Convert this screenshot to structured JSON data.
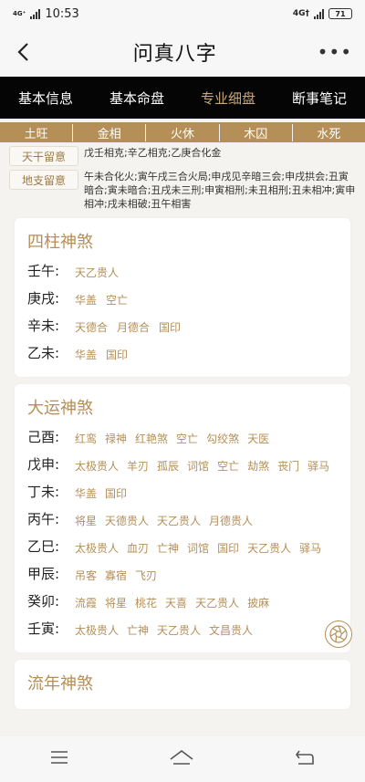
{
  "status": {
    "network": "4G⁺",
    "time": "10:53",
    "right_network": "4G†",
    "battery": "71"
  },
  "header": {
    "title": "问真八字"
  },
  "tabs": [
    {
      "label": "基本信息"
    },
    {
      "label": "基本命盘"
    },
    {
      "label": "专业细盘"
    },
    {
      "label": "断事笔记"
    }
  ],
  "wuxing": [
    "土旺",
    "金相",
    "火休",
    "木囚",
    "水死"
  ],
  "liu": {
    "tiangan_label": "天干留意",
    "tiangan_text": "戊壬相克;辛乙相克;乙庚合化金",
    "dizhi_label": "地支留意",
    "dizhi_text": "午未合化火;寅午戌三合火局;申戌见辛暗三会;申戌拱会;丑寅暗合;寅未暗合;丑戌未三刑;申寅相刑;未丑相刑;丑未相冲;寅申相冲;戌未相破;丑午相害"
  },
  "sizhu": {
    "title": "四柱神煞",
    "rows": [
      {
        "gz": "壬午:",
        "tags": [
          "天乙贵人"
        ]
      },
      {
        "gz": "庚戌:",
        "tags": [
          "华盖",
          "空亡"
        ]
      },
      {
        "gz": "辛未:",
        "tags": [
          "天德合",
          "月德合",
          "国印"
        ]
      },
      {
        "gz": "乙未:",
        "tags": [
          "华盖",
          "国印"
        ]
      }
    ]
  },
  "dayun": {
    "title": "大运神煞",
    "rows": [
      {
        "gz": "己酉:",
        "tags": [
          "红鸾",
          "禄神",
          "红艳煞",
          "空亡",
          "勾绞煞",
          "天医"
        ]
      },
      {
        "gz": "戊申:",
        "tags": [
          "太极贵人",
          "羊刃",
          "孤辰",
          "词馆",
          "空亡",
          "劫煞",
          "丧门",
          "驿马"
        ]
      },
      {
        "gz": "丁未:",
        "tags": [
          "华盖",
          "国印"
        ]
      },
      {
        "gz": "丙午:",
        "tags": [
          "将星",
          "天德贵人",
          "天乙贵人",
          "月德贵人"
        ]
      },
      {
        "gz": "乙巳:",
        "tags": [
          "太极贵人",
          "血刃",
          "亡神",
          "词馆",
          "国印",
          "天乙贵人",
          "驿马"
        ]
      },
      {
        "gz": "甲辰:",
        "tags": [
          "吊客",
          "寡宿",
          "飞刃"
        ]
      },
      {
        "gz": "癸卯:",
        "tags": [
          "流霞",
          "将星",
          "桃花",
          "天喜",
          "天乙贵人",
          "披麻"
        ]
      },
      {
        "gz": "壬寅:",
        "tags": [
          "太极贵人",
          "亡神",
          "天乙贵人",
          "文昌贵人"
        ]
      }
    ]
  },
  "liunian": {
    "title": "流年神煞"
  },
  "colors": {
    "accent": "#b48f58",
    "tab_bg": "#050505",
    "tab_active": "#c9a97a"
  }
}
